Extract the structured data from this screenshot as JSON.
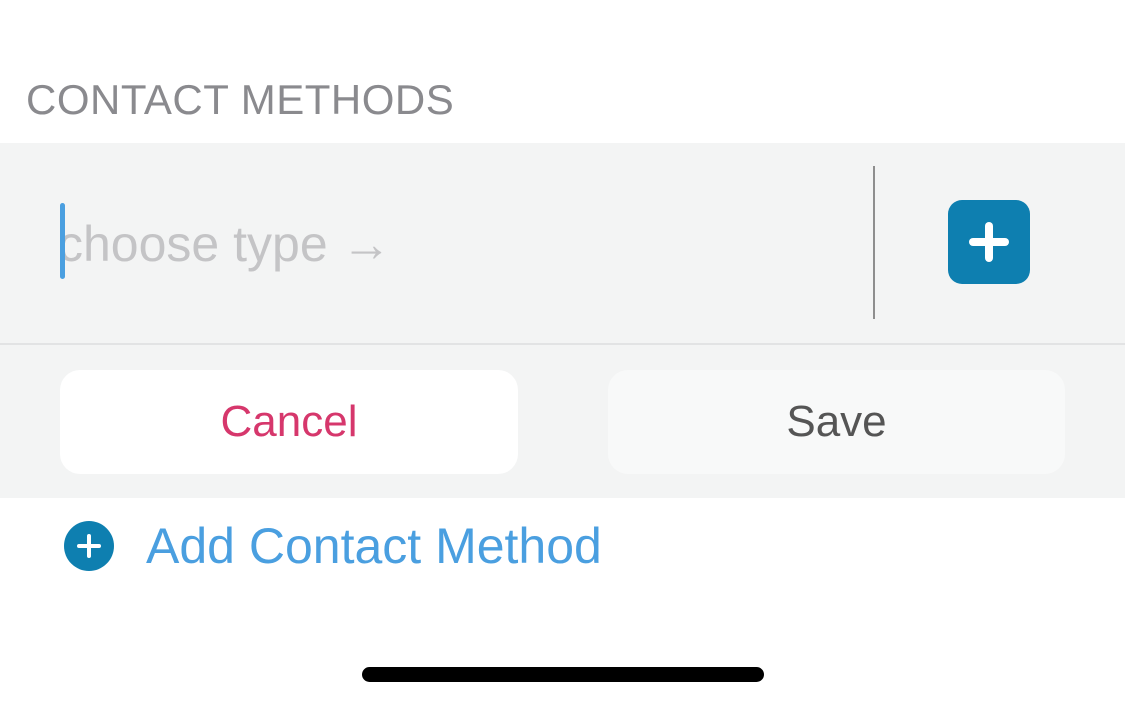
{
  "section": {
    "header": "CONTACT METHODS"
  },
  "editor": {
    "type_placeholder": "choose type →",
    "type_value": "",
    "add_icon": "plus-icon",
    "cancel_label": "Cancel",
    "save_label": "Save"
  },
  "add_method": {
    "icon": "plus-circle-icon",
    "label": "Add Contact Method"
  },
  "colors": {
    "accent_blue": "#0e7fb0",
    "link_blue": "#4a9fe0",
    "cancel_red": "#d6376c",
    "panel_bg": "#f3f4f4",
    "header_gray": "#8a8a8e"
  }
}
